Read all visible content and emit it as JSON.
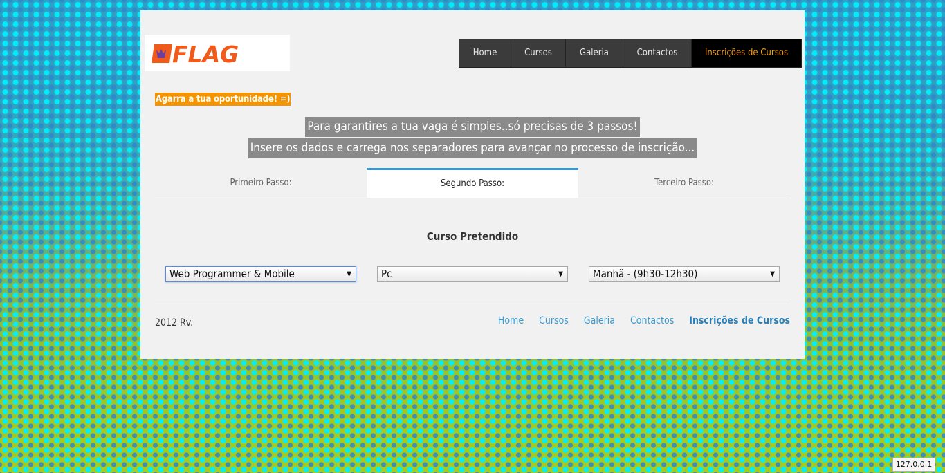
{
  "brand": {
    "logo_text": "FLAG",
    "logo_colors": {
      "orange": "#f05a1a",
      "purple": "#6a3fa0"
    }
  },
  "topnav": {
    "items": [
      {
        "label": "Home",
        "active": false
      },
      {
        "label": "Cursos",
        "active": false
      },
      {
        "label": "Galeria",
        "active": false
      },
      {
        "label": "Contactos",
        "active": false
      },
      {
        "label": "Inscrições de Cursos",
        "active": true
      }
    ]
  },
  "tagline": "Agarra a tua oportunidade! =)",
  "intro": {
    "line1": "Para garantires a tua vaga é simples..só precisas de 3 passos!",
    "line2": "Insere os dados e carrega nos separadores para avançar no processo de inscrição..."
  },
  "tabs": [
    {
      "label": "Primeiro Passo:",
      "active": false
    },
    {
      "label": "Segundo Passo:",
      "active": true
    },
    {
      "label": "Terceiro Passo:",
      "active": false
    }
  ],
  "form": {
    "title": "Curso Pretendido",
    "course_select": "Web Programmer & Mobile",
    "platform_select": "Pc",
    "schedule_select": "Manhã - (9h30-12h30)"
  },
  "footer": {
    "copyright": "2012 Rv.",
    "nav": [
      {
        "label": "Home",
        "active": false
      },
      {
        "label": "Cursos",
        "active": false
      },
      {
        "label": "Galeria",
        "active": false
      },
      {
        "label": "Contactos",
        "active": false
      },
      {
        "label": "Inscrições de Cursos",
        "active": true
      }
    ]
  },
  "status_host": "127.0.0.1",
  "colors": {
    "accent_blue": "#3498db",
    "tagline_orange": "#f39400",
    "nav_active_text": "#f39c12"
  }
}
